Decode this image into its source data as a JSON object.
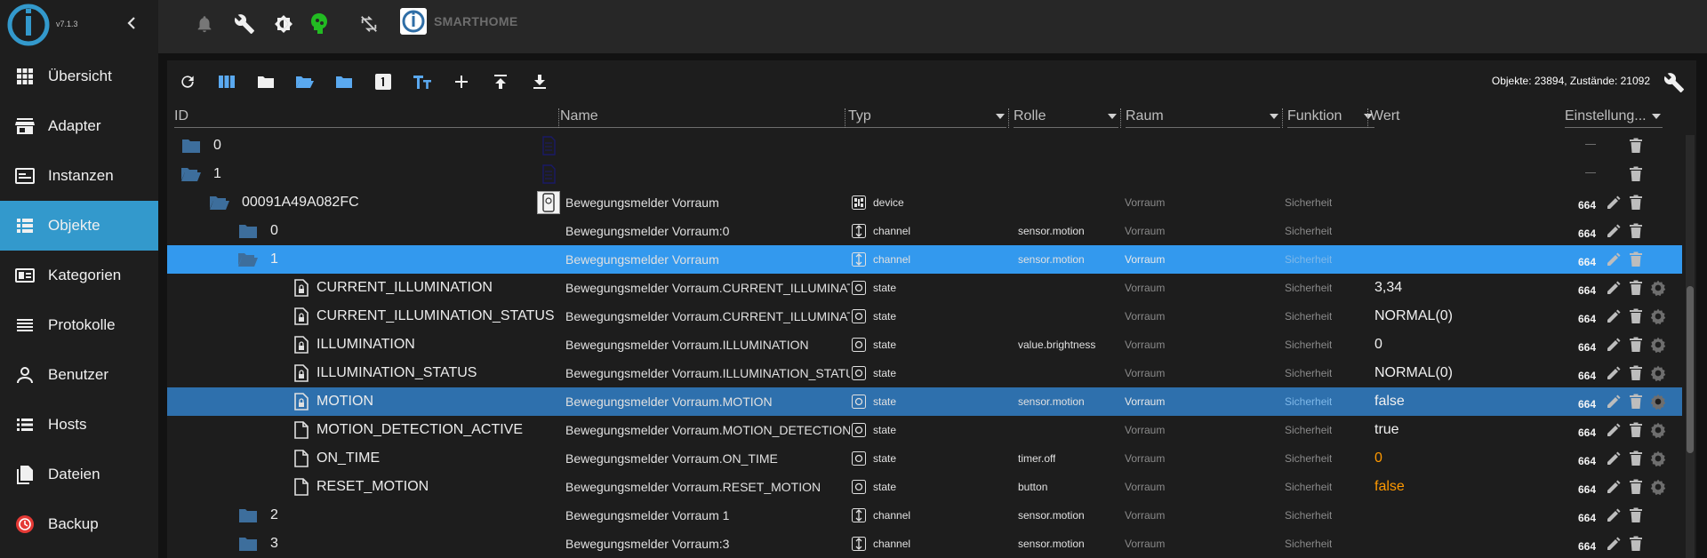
{
  "app": {
    "version": "v7.1.3",
    "brand_name": "SMARTHOME"
  },
  "sidebar": {
    "items": [
      {
        "label": "Übersicht",
        "icon": "grid-icon",
        "active": false
      },
      {
        "label": "Adapter",
        "icon": "store-icon",
        "active": false
      },
      {
        "label": "Instanzen",
        "icon": "instances-icon",
        "active": false
      },
      {
        "label": "Objekte",
        "icon": "list-icon",
        "active": true
      },
      {
        "label": "Kategorien",
        "icon": "categories-icon",
        "active": false
      },
      {
        "label": "Protokolle",
        "icon": "log-icon",
        "active": false
      },
      {
        "label": "Benutzer",
        "icon": "user-icon",
        "active": false
      },
      {
        "label": "Hosts",
        "icon": "hosts-icon",
        "active": false
      },
      {
        "label": "Dateien",
        "icon": "files-icon",
        "active": false
      },
      {
        "label": "Backup",
        "icon": "backup-icon",
        "active": false
      }
    ]
  },
  "toolbar": {
    "counter": "Objekte: 23894, Zustände: 21092"
  },
  "columns": {
    "id": "ID",
    "name": "Name",
    "type": "Typ",
    "role": "Rolle",
    "room": "Raum",
    "function": "Funktion",
    "value": "Wert",
    "settings": "Einstellung..."
  },
  "rows": [
    {
      "id": "0",
      "kind": "folder-closed",
      "name": "",
      "type": "",
      "role": "",
      "room": "",
      "func": "",
      "value": "",
      "acl": "",
      "extra": "dash"
    },
    {
      "id": "1",
      "kind": "folder-open",
      "name": "",
      "type": "",
      "role": "",
      "room": "",
      "func": "",
      "value": "",
      "acl": "",
      "extra": "dash"
    },
    {
      "id": "00091A49A082FC",
      "kind": "folder-open",
      "name": "Bewegungsmelder Vorraum",
      "type": "device",
      "role": "",
      "room": "Vorraum",
      "func": "Sicherheit",
      "value": "",
      "acl": "664"
    },
    {
      "id": "0",
      "kind": "folder-closed",
      "name": "Bewegungsmelder Vorraum:0",
      "type": "channel",
      "role": "sensor.motion",
      "room": "Vorraum",
      "func": "Sicherheit",
      "value": "",
      "acl": "664"
    },
    {
      "id": "1",
      "kind": "folder-open",
      "name": "Bewegungsmelder Vorraum",
      "type": "channel",
      "role": "sensor.motion",
      "room": "Vorraum",
      "func": "Sicherheit",
      "value": "",
      "acl": "664",
      "selected": "sel1"
    },
    {
      "id": "CURRENT_ILLUMINATION",
      "kind": "file-lock",
      "name": "Bewegungsmelder Vorraum.CURRENT_ILLUMINATI...",
      "type": "state",
      "role": "",
      "room": "Vorraum",
      "func": "Sicherheit",
      "value": "3,34",
      "acl": "664",
      "gear": true
    },
    {
      "id": "CURRENT_ILLUMINATION_STATUS",
      "kind": "file-lock",
      "name": "Bewegungsmelder Vorraum.CURRENT_ILLUMINATI...",
      "type": "state",
      "role": "",
      "room": "Vorraum",
      "func": "Sicherheit",
      "value": "NORMAL(0)",
      "acl": "664",
      "gear": true
    },
    {
      "id": "ILLUMINATION",
      "kind": "file-lock",
      "name": "Bewegungsmelder Vorraum.ILLUMINATION",
      "type": "state",
      "role": "value.brightness",
      "room": "Vorraum",
      "func": "Sicherheit",
      "value": "0",
      "acl": "664",
      "gear": true
    },
    {
      "id": "ILLUMINATION_STATUS",
      "kind": "file-lock",
      "name": "Bewegungsmelder Vorraum.ILLUMINATION_STATUS",
      "type": "state",
      "role": "",
      "room": "Vorraum",
      "func": "Sicherheit",
      "value": "NORMAL(0)",
      "acl": "664",
      "gear": true
    },
    {
      "id": "MOTION",
      "kind": "file-lock",
      "name": "Bewegungsmelder Vorraum.MOTION",
      "type": "state",
      "role": "sensor.motion",
      "room": "Vorraum",
      "func": "Sicherheit",
      "value": "false",
      "acl": "664",
      "gear": true,
      "selected": "sel2"
    },
    {
      "id": "MOTION_DETECTION_ACTIVE",
      "kind": "file",
      "name": "Bewegungsmelder Vorraum.MOTION_DETECTION_...",
      "type": "state",
      "role": "",
      "room": "Vorraum",
      "func": "Sicherheit",
      "value": "true",
      "acl": "664",
      "gear": true
    },
    {
      "id": "ON_TIME",
      "kind": "file",
      "name": "Bewegungsmelder Vorraum.ON_TIME",
      "type": "state",
      "role": "timer.off",
      "room": "Vorraum",
      "func": "Sicherheit",
      "value": "0",
      "value_color": "orange",
      "acl": "664",
      "gear": true
    },
    {
      "id": "RESET_MOTION",
      "kind": "file",
      "name": "Bewegungsmelder Vorraum.RESET_MOTION",
      "type": "state",
      "role": "button",
      "room": "Vorraum",
      "func": "Sicherheit",
      "value": "false",
      "value_color": "orange",
      "acl": "664",
      "gear": true
    },
    {
      "id": "2",
      "kind": "folder-closed",
      "name": "Bewegungsmelder Vorraum 1",
      "type": "channel",
      "role": "sensor.motion",
      "room": "Vorraum",
      "func": "Sicherheit",
      "value": "",
      "acl": "664"
    },
    {
      "id": "3",
      "kind": "folder-closed",
      "name": "Bewegungsmelder Vorraum:3",
      "type": "channel",
      "role": "sensor.motion",
      "room": "Vorraum",
      "func": "Sicherheit",
      "value": "",
      "acl": "664"
    }
  ],
  "colors": {
    "accent": "#3399cc",
    "folder": "#3d6e9c",
    "selected_light": "#3399ee",
    "selected_dark": "#2e70ad",
    "value_highlight": "#ff9900"
  }
}
